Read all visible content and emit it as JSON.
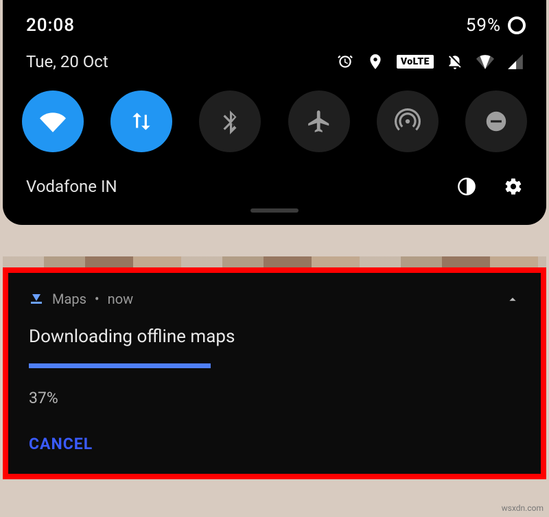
{
  "statusbar": {
    "time": "20:08",
    "battery_text": "59%"
  },
  "shade": {
    "date": "Tue, 20 Oct",
    "volte_label": "VoLTE",
    "carrier": "Vodafone IN",
    "tiles": {
      "wifi": {
        "active": true
      },
      "data": {
        "active": true
      },
      "bluetooth": {
        "active": false
      },
      "airplane": {
        "active": false
      },
      "hotspot": {
        "active": false
      },
      "dnd": {
        "active": false
      }
    }
  },
  "notification": {
    "app": "Maps",
    "separator": "•",
    "when": "now",
    "title": "Downloading offline maps",
    "progress_pct": 37,
    "progress_label": "37%",
    "cancel_label": "CANCEL"
  },
  "watermark": "wsxdn.com"
}
